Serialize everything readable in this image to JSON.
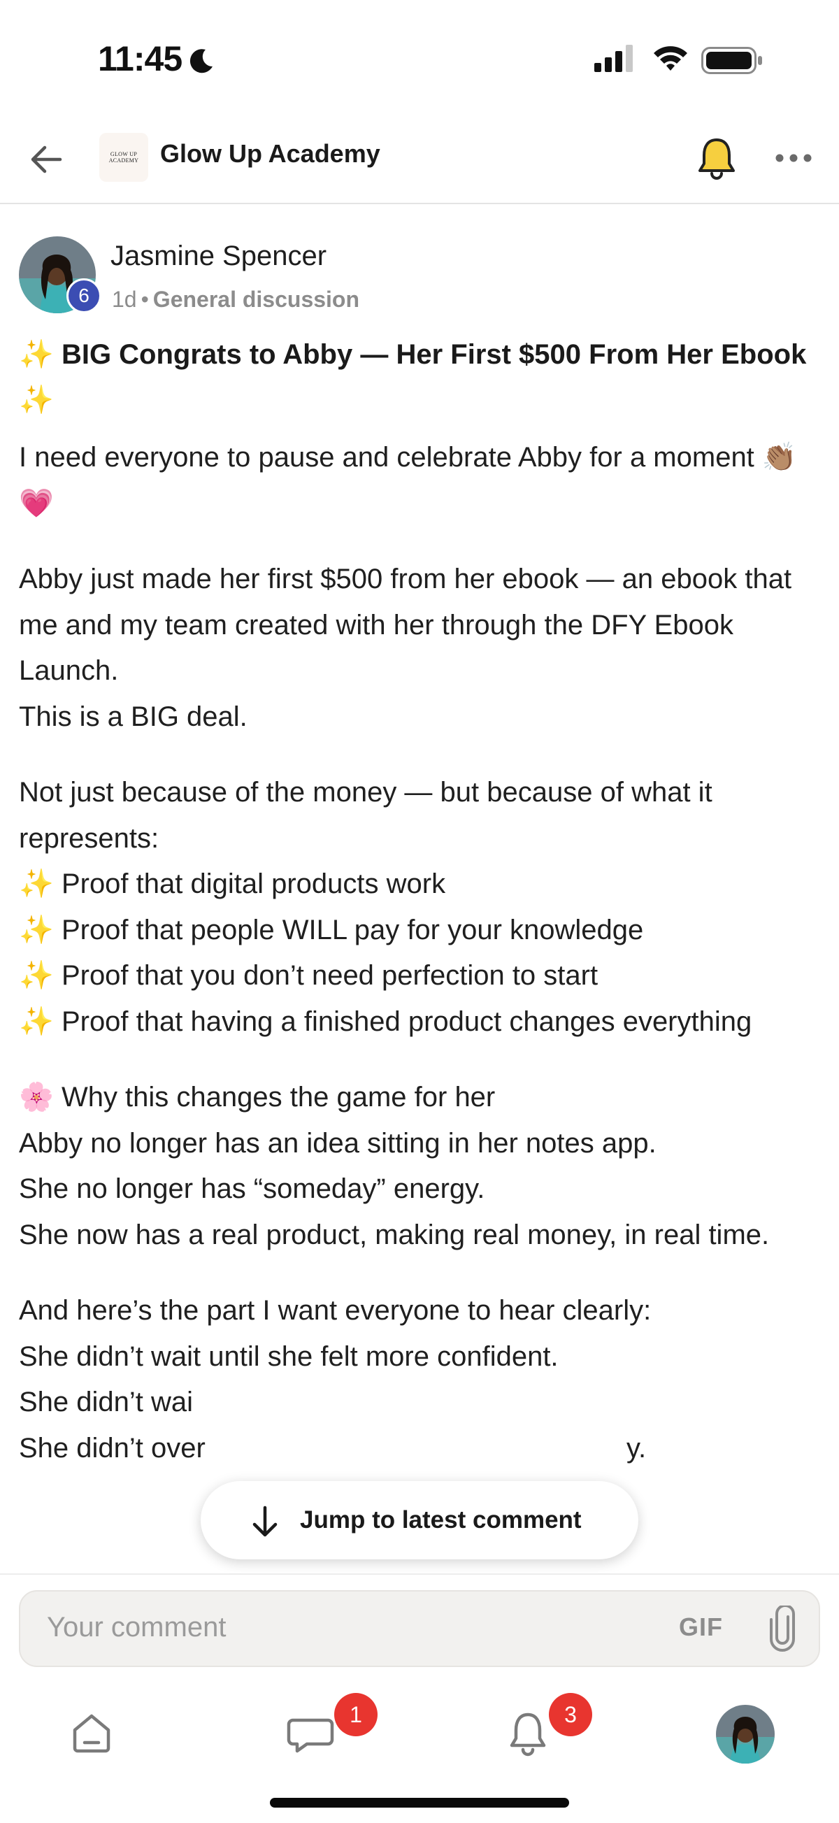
{
  "status_bar": {
    "time": "11:45"
  },
  "header": {
    "group_name": "Glow Up Academy",
    "logo_text": "GLOW UP ACADEMY"
  },
  "post": {
    "author": "Jasmine Spencer",
    "level": "6",
    "age": "1d",
    "separator": "•",
    "category": "General discussion",
    "title_sparkle": "✨",
    "title": "BIG Congrats to Abby — Her First $500 From Her Ebook",
    "intro": "I need everyone to pause and celebrate Abby for a moment",
    "intro_emoji": "👏🏽💗",
    "p2_lines": [
      "Abby just made her first $500 from her ebook — an ebook that me and my team created with her through the DFY Ebook Launch.",
      "This is a BIG deal."
    ],
    "p3_intro": "Not just because of the money — but because of what it represents:",
    "proofs": [
      "Proof that digital products work",
      "Proof that people WILL pay for your knowledge",
      "Proof that you don’t need perfection to start",
      "Proof that having a finished product changes everything"
    ],
    "flower_emoji": "🌸",
    "p4_heading": "Why this changes the game for her",
    "p4_lines": [
      "Abby no longer has an idea sitting in her notes app.",
      "She no longer has “someday” energy.",
      "She now has a real product, making real money, in real time."
    ],
    "p5_lines": [
      "And here’s the part I want everyone to hear clearly:",
      "She didn’t wait until she felt more confident.",
      "She didn’t wai",
      "She didn’t over"
    ],
    "p5_trailing": "y."
  },
  "jump": {
    "label": "Jump to latest comment"
  },
  "composer": {
    "placeholder": "Your comment",
    "gif_label": "GIF"
  },
  "tabbar": {
    "chat_badge": "1",
    "notifications_badge": "3"
  },
  "colors": {
    "level_badge": "#3b4db3",
    "badge_red": "#e8352f",
    "bell_yellow": "#f6cf3f"
  }
}
